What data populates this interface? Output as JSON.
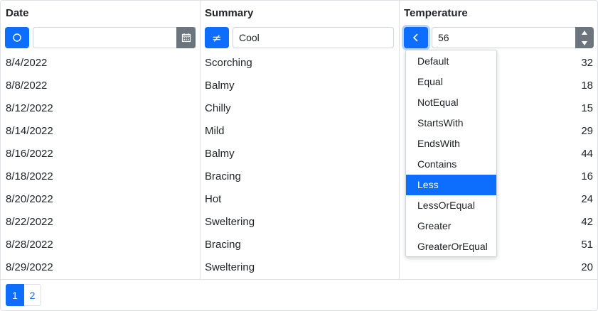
{
  "columns": {
    "date": "Date",
    "summary": "Summary",
    "temperature": "Temperature"
  },
  "filters": {
    "date": {
      "value": "",
      "operator_icon": "circle-icon"
    },
    "summary": {
      "value": "Cool",
      "operator_icon": "not-equal-icon",
      "operator_symbol": "≠"
    },
    "temperature": {
      "value": "56",
      "operator_icon": "chevron-left-icon"
    }
  },
  "rows": [
    {
      "date": "8/4/2022",
      "summary": "Scorching",
      "temperature": "32"
    },
    {
      "date": "8/8/2022",
      "summary": "Balmy",
      "temperature": "18"
    },
    {
      "date": "8/12/2022",
      "summary": "Chilly",
      "temperature": "15"
    },
    {
      "date": "8/14/2022",
      "summary": "Mild",
      "temperature": "29"
    },
    {
      "date": "8/16/2022",
      "summary": "Balmy",
      "temperature": "44"
    },
    {
      "date": "8/18/2022",
      "summary": "Bracing",
      "temperature": "16"
    },
    {
      "date": "8/20/2022",
      "summary": "Hot",
      "temperature": "24"
    },
    {
      "date": "8/22/2022",
      "summary": "Sweltering",
      "temperature": "42"
    },
    {
      "date": "8/28/2022",
      "summary": "Bracing",
      "temperature": "51"
    },
    {
      "date": "8/29/2022",
      "summary": "Sweltering",
      "temperature": "20"
    }
  ],
  "operator_menu": {
    "items": [
      "Default",
      "Equal",
      "NotEqual",
      "StartsWith",
      "EndsWith",
      "Contains",
      "Less",
      "LessOrEqual",
      "Greater",
      "GreaterOrEqual"
    ],
    "selected": "Less"
  },
  "pager": {
    "pages": [
      "1",
      "2"
    ],
    "current": "1"
  },
  "colors": {
    "accent": "#0d6efd",
    "secondary": "#6c757d",
    "border": "#dee2e6"
  }
}
